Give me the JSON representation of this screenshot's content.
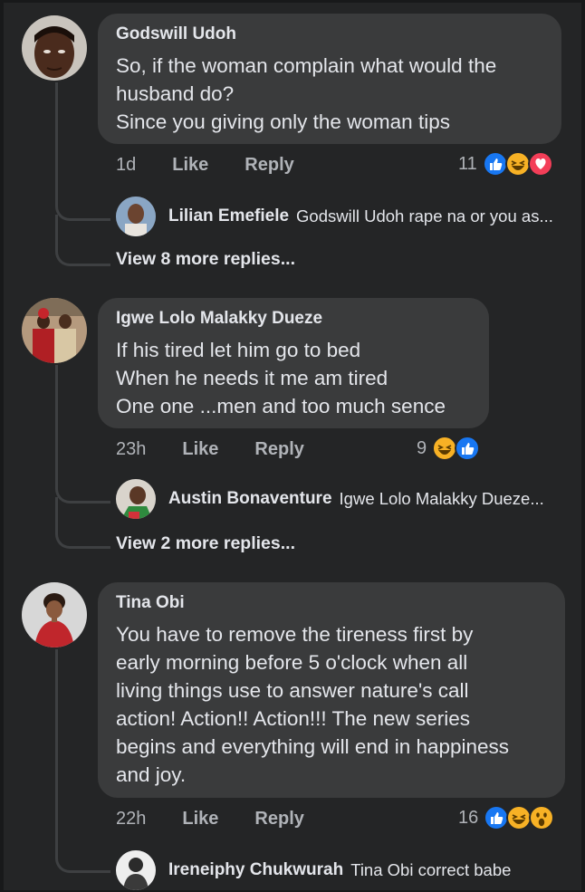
{
  "comments": [
    {
      "author": "Godswill Udoh",
      "lines": [
        "So, if the woman complain what would the",
        "husband do?",
        "Since you giving only the woman tips"
      ],
      "time": "1d",
      "like": "Like",
      "reply": "Reply",
      "reaction_count": "11",
      "reactions": [
        "like-icon",
        "haha-icon",
        "love-icon"
      ],
      "reply_preview": {
        "name": "Lilian Emefiele",
        "text": "Godswill Udoh rape na or you as..."
      },
      "view_more": "View 8 more replies..."
    },
    {
      "author": "Igwe Lolo Malakky Dueze",
      "lines": [
        "If his tired let him go to bed",
        "When he needs it me am tired",
        "One one ...men and too much sence"
      ],
      "time": "23h",
      "like": "Like",
      "reply": "Reply",
      "reaction_count": "9",
      "reactions": [
        "haha-icon",
        "like-icon"
      ],
      "reply_preview": {
        "name": "Austin Bonaventure",
        "text": "Igwe Lolo Malakky Dueze..."
      },
      "view_more": "View 2 more replies..."
    },
    {
      "author": "Tina Obi",
      "lines": [
        "You have to remove the tireness first by",
        "early morning before 5 o'clock when all",
        "living things use to answer nature's call",
        "action! Action!! Action!!! The new series",
        "begins and everything will end in happiness",
        "and joy."
      ],
      "time": "22h",
      "like": "Like",
      "reply": "Reply",
      "reaction_count": "16",
      "reactions": [
        "like-icon",
        "haha-icon",
        "wow-icon"
      ],
      "reply_preview": {
        "name": "Ireneiphy Chukwurah",
        "text": "Tina Obi correct babe"
      }
    }
  ],
  "colors": {
    "background": "#242526",
    "bubble": "#3a3b3c",
    "like_blue": "#1877f2",
    "love_red": "#f33e58",
    "haha_yellow": "#f7b125"
  }
}
